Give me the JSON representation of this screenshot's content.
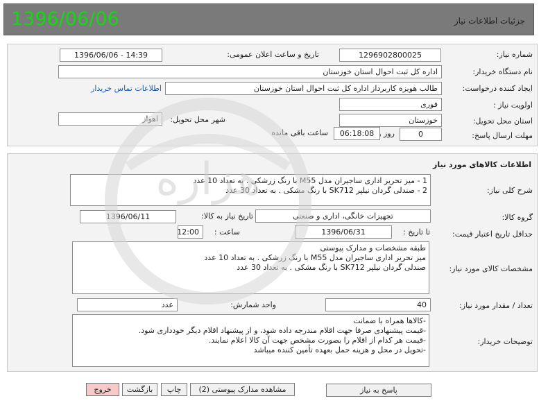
{
  "header": {
    "title": "جزئیات اطلاعات نیاز",
    "date": "1396/06/06"
  },
  "info": {
    "need_number_label": "شماره نیاز:",
    "need_number": "1296902800025",
    "announce_label": "تاریخ و ساعت اعلان عمومی:",
    "announce_value": "1396/06/06 - 14:39",
    "buyer_org_label": "نام دستگاه خریدار:",
    "buyer_org": "اداره کل ثبت احوال استان خوزستان",
    "creator_label": "ایجاد کننده درخواست:",
    "creator": "طالب هویزه کاربرداز اداره کل ثبت احوال استان خوزستان",
    "contact_link": "اطلاعات تماس خریدار",
    "priority_label": "اولویت نیاز :",
    "priority": "فوری",
    "province_label": "استان محل تحویل:",
    "province": "خوزستان",
    "city_label": "شهر محل تحویل:",
    "city": "اهواز",
    "deadline_label": "مهلت ارسال پاسخ:",
    "deadline_days": "0",
    "days_word": "روز و",
    "deadline_time": "06:18:08",
    "remaining_word": "ساعت باقی مانده"
  },
  "goods": {
    "section_title": "اطلاعات کالاهای مورد نیاز",
    "summary_label": "شرح کلی نیاز:",
    "summary_lines": [
      "1 - میز تحریر اداری ساجیران مدل M55 با رنگ زرشکی  .   به تعداد 10 عدد",
      "2 - صندلی گردان نیلپر SK712  با رنگ مشکی  .  به تعداد 30 عدد"
    ],
    "group_label": "گروه کالا:",
    "group_value": "تجهیزات خانگی، اداری و صنعتی",
    "need_date_label": "تاریخ نیاز به کالا:",
    "need_date": "1396/06/11",
    "validity_label": "حداقل تاریخ اعتبار قیمت:",
    "until_label": "تا تاریخ :",
    "validity_date": "1396/06/31",
    "time_label": "ساعت :",
    "validity_time": "12:00",
    "specs_label": "مشخصات کالای مورد نیاز:",
    "specs_lines": [
      "طبقه مشخصات و مدارک پیوستی",
      " میز تحریر اداری ساجیران مدل M55 با رنگ زرشکی  .   به تعداد 10 عدد",
      " صندلی گردان نیلپر SK712  با رنگ مشکی  .  به تعداد 30 عدد"
    ],
    "qty_label": "تعداد / مقدار مورد نیاز:",
    "qty_value": "40",
    "unit_label": "واحد شمارش:",
    "unit_value": "عدد",
    "notes_label": "توضیحات خریدار:",
    "notes_lines": [
      "-کالاها همراه با ضمانت",
      "-قیمت پیشنهادی صرفا جهت اقلام مندرجه داده شود، و از پیشنهاد اقلام دیگر خودداری شود.",
      "-قیمت هر کدام از اقلام را بصورت مشخص جهت آن کالا اعلام نمایند.",
      "-تحویل در محل و هزینه حمل بعهده تأمین کننده میباشد"
    ]
  },
  "buttons": {
    "reply": "پاسخ به نیاز",
    "attachments": "مشاهده مدارک پیوستی (2)",
    "print": "چاپ",
    "back": "بازگشت",
    "exit": "خروج"
  },
  "watermark": {
    "text": "هزاره"
  },
  "colors": {
    "date": "#12d912",
    "header_bg": "#7a7a7a",
    "link": "#1a5cb0",
    "exit_btn": "#f7c9c9"
  }
}
